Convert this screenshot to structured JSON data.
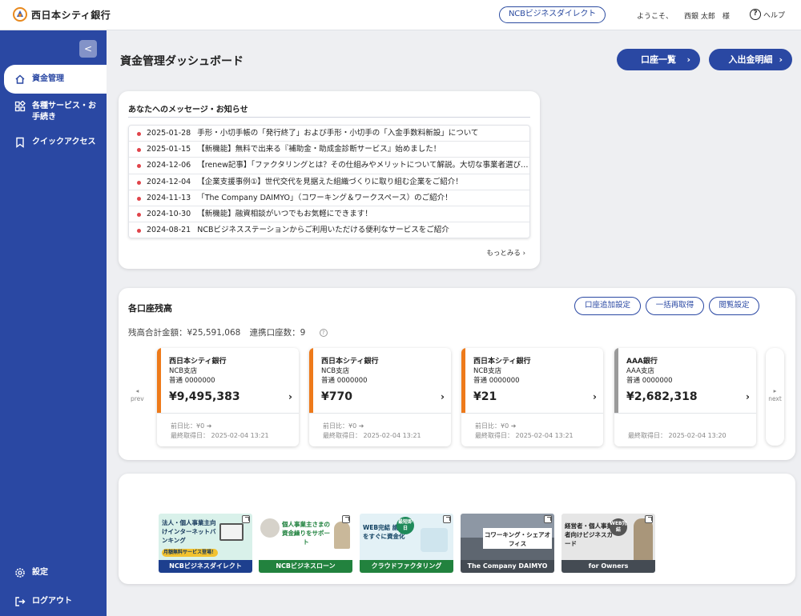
{
  "header": {
    "bank_name": "西日本シティ銀行",
    "service_link": "NCBビジネスダイレクト",
    "welcome": "ようこそ、",
    "user_name": "西銀 太郎　様",
    "help": "ヘルプ"
  },
  "sidebar": {
    "collapse_glyph": "<",
    "items": [
      {
        "label": "資金管理",
        "icon": "home-icon",
        "active": true
      },
      {
        "label": "各種サービス・お手続き",
        "icon": "grid-icon"
      },
      {
        "label": "クイックアクセス",
        "icon": "bookmark-icon"
      },
      {
        "label": "設定",
        "icon": "gear-icon"
      },
      {
        "label": "ログアウト",
        "icon": "logout-icon"
      }
    ]
  },
  "main": {
    "title": "資金管理ダッシュボード",
    "account_list_button": "口座一覧",
    "statement_button": "入出金明細"
  },
  "messages": {
    "title": "あなたへのメッセージ・お知らせ",
    "items": [
      {
        "date": "2025-01-28",
        "text": "手形・小切手帳の「発行終了」および手形・小切手の「入金手数料新設」について"
      },
      {
        "date": "2025-01-15",
        "text": "【新機能】無料で出来る『補助金・助成金診断サービス』始めました！"
      },
      {
        "date": "2024-12-06",
        "text": "【renew記事】｢ファクタリングとは？その仕組みやメリットについて解説。大切な事業者選び…"
      },
      {
        "date": "2024-12-04",
        "text": "【企業支援事例①】世代交代を見据えた組織づくりに取り組む企業をご紹介！"
      },
      {
        "date": "2024-11-13",
        "text": "「The Company DAIMYO」（コワーキング＆ワークスペース）のご紹介！"
      },
      {
        "date": "2024-10-30",
        "text": "【新機能】融資相談がいつでもお気軽にできます！"
      },
      {
        "date": "2024-08-21",
        "text": "NCBビジネスステーションからご利用いただける便利なサービスをご紹介"
      }
    ],
    "more_link": "もっとみる ›"
  },
  "balances": {
    "title": "各口座残高",
    "add_account_button": "口座追加設定",
    "refresh_button": "一括再取得",
    "view_settings_button": "閲覧設定",
    "total_label": "残高合計金額：",
    "total_value": "¥25,591,068",
    "count_label": "連携口座数：",
    "count_value": "9",
    "prev": "prev",
    "next": "next",
    "accounts": [
      {
        "bank": "西日本シティ銀行",
        "branch": "NCB支店",
        "number": "普通 0000000",
        "amount": "¥9,495,383",
        "diff": "前日比：¥0 ➜",
        "fetched": "最終取得日： 2025-02-04 13:21",
        "accent": "#ee7a1a"
      },
      {
        "bank": "西日本シティ銀行",
        "branch": "NCB支店",
        "number": "普通 0000000",
        "amount": "¥770",
        "diff": "前日比：¥0 ➜",
        "fetched": "最終取得日： 2025-02-04 13:21",
        "accent": "#ee7a1a"
      },
      {
        "bank": "西日本シティ銀行",
        "branch": "NCB支店",
        "number": "普通 0000000",
        "amount": "¥21",
        "diff": "前日比：¥0 ➜",
        "fetched": "最終取得日： 2025-02-04 13:21",
        "accent": "#ee7a1a"
      },
      {
        "bank": "AAA銀行",
        "branch": "AAA支店",
        "number": "普通 0000000",
        "amount": "¥2,682,318",
        "diff": "",
        "fetched": "最終取得日： 2025-02-04 13:20",
        "accent": "#9a9a9a"
      }
    ]
  },
  "banners": [
    {
      "label": "NCBビジネスダイレクト",
      "text": "法人・個人事業主向けインターネットバンキング",
      "sub": "月額無料サービス登場！"
    },
    {
      "label": "NCBビジネスローン",
      "text": "個人事業主さまの資金繰りをサポート"
    },
    {
      "label": "クラウドファクタリング",
      "text": "WEB完結 請求書をすぐに資金化",
      "badge": "最短即日"
    },
    {
      "label": "The Company DAIMYO",
      "text": "コワーキング・シェアオフィス"
    },
    {
      "label": "for Owners",
      "text": "経営者・個人事業者向けビジネスカード",
      "badge": "WEB完結"
    }
  ],
  "colors": {
    "brand_blue": "#2a48a3",
    "accent_orange": "#ee7a1a",
    "news_dot": "#e0444a"
  }
}
